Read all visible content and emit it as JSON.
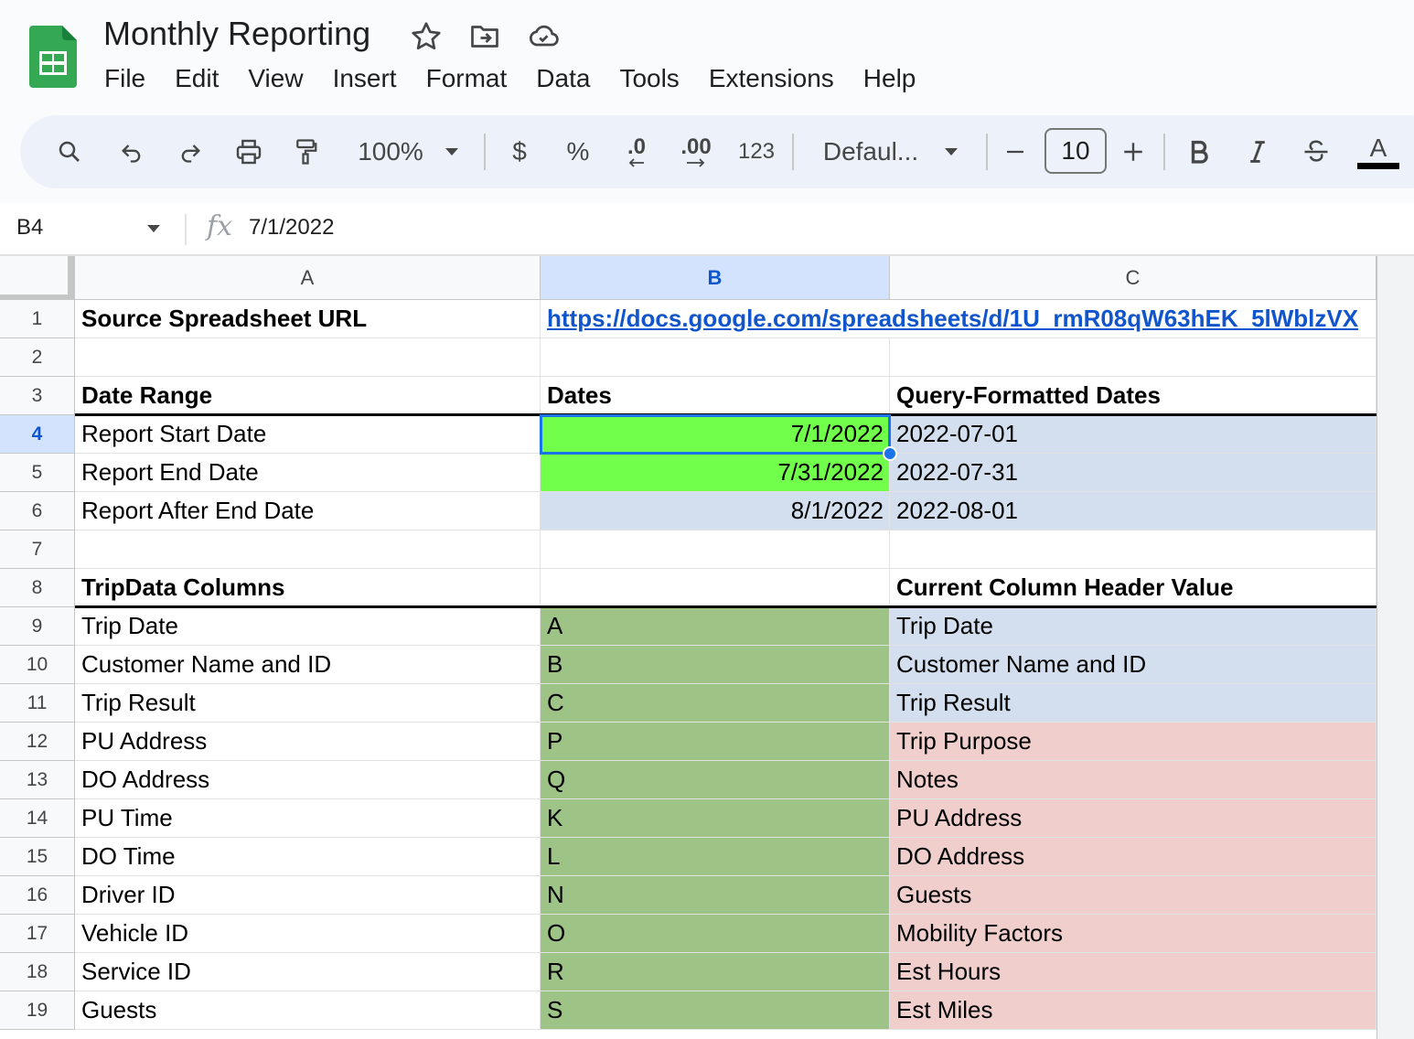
{
  "app": {
    "doc_title": "Monthly Reporting",
    "icons": [
      "sheets-logo-icon",
      "star-icon",
      "move-folder-icon",
      "cloud-saved-icon"
    ]
  },
  "menu": [
    "File",
    "Edit",
    "View",
    "Insert",
    "Format",
    "Data",
    "Tools",
    "Extensions",
    "Help"
  ],
  "toolbar": {
    "zoom": "100%",
    "currency": "$",
    "percent": "%",
    "decrease_decimals": ".0",
    "increase_decimals": ".00",
    "number_format": "123",
    "font": "Defaul...",
    "font_size": "10",
    "text_color_label": "A",
    "text_color": "#000000"
  },
  "formula_bar": {
    "name_box": "B4",
    "fx": "fx",
    "value": "7/1/2022"
  },
  "grid": {
    "selected_cell": "B4",
    "columns": [
      {
        "id": "A",
        "label": "A"
      },
      {
        "id": "B",
        "label": "B"
      },
      {
        "id": "C",
        "label": "C"
      }
    ],
    "rows": [
      {
        "num": "1",
        "a": "Source Spreadsheet URL",
        "b": "https://docs.google.com/spreadsheets/d/1U_rmR08qW63hEK_5lWblzVX",
        "c": ""
      },
      {
        "num": "2",
        "a": "",
        "b": "",
        "c": ""
      },
      {
        "num": "3",
        "a": "Date Range",
        "b": "Dates",
        "c": "Query-Formatted Dates"
      },
      {
        "num": "4",
        "a": "Report Start Date",
        "b": "7/1/2022",
        "c": "2022-07-01"
      },
      {
        "num": "5",
        "a": "Report End Date",
        "b": "7/31/2022",
        "c": "2022-07-31"
      },
      {
        "num": "6",
        "a": "Report After End Date",
        "b": "8/1/2022",
        "c": "2022-08-01"
      },
      {
        "num": "7",
        "a": "",
        "b": "",
        "c": ""
      },
      {
        "num": "8",
        "a": "TripData Columns",
        "b": "",
        "c": "Current Column Header Value"
      },
      {
        "num": "9",
        "a": "Trip Date",
        "b": "A",
        "c": "Trip Date"
      },
      {
        "num": "10",
        "a": "Customer Name and ID",
        "b": "B",
        "c": "Customer Name and ID"
      },
      {
        "num": "11",
        "a": "Trip Result",
        "b": "C",
        "c": "Trip Result"
      },
      {
        "num": "12",
        "a": "PU Address",
        "b": "P",
        "c": "Trip Purpose"
      },
      {
        "num": "13",
        "a": "DO Address",
        "b": "Q",
        "c": "Notes"
      },
      {
        "num": "14",
        "a": "PU Time",
        "b": "K",
        "c": "PU Address"
      },
      {
        "num": "15",
        "a": "DO Time",
        "b": "L",
        "c": "DO Address"
      },
      {
        "num": "16",
        "a": "Driver ID",
        "b": "N",
        "c": "Guests"
      },
      {
        "num": "17",
        "a": "Vehicle ID",
        "b": "O",
        "c": "Mobility Factors"
      },
      {
        "num": "18",
        "a": "Service ID",
        "b": "R",
        "c": "Est Hours"
      },
      {
        "num": "19",
        "a": "Guests",
        "b": "S",
        "c": "Est Miles"
      }
    ],
    "colors": {
      "input_green": "#72ff4b",
      "letter_green": "#9dc386",
      "match_blue": "#d3dfee",
      "mismatch_red": "#efcecc",
      "link_blue": "#1155cc",
      "selection_blue": "#1a73e8"
    }
  }
}
